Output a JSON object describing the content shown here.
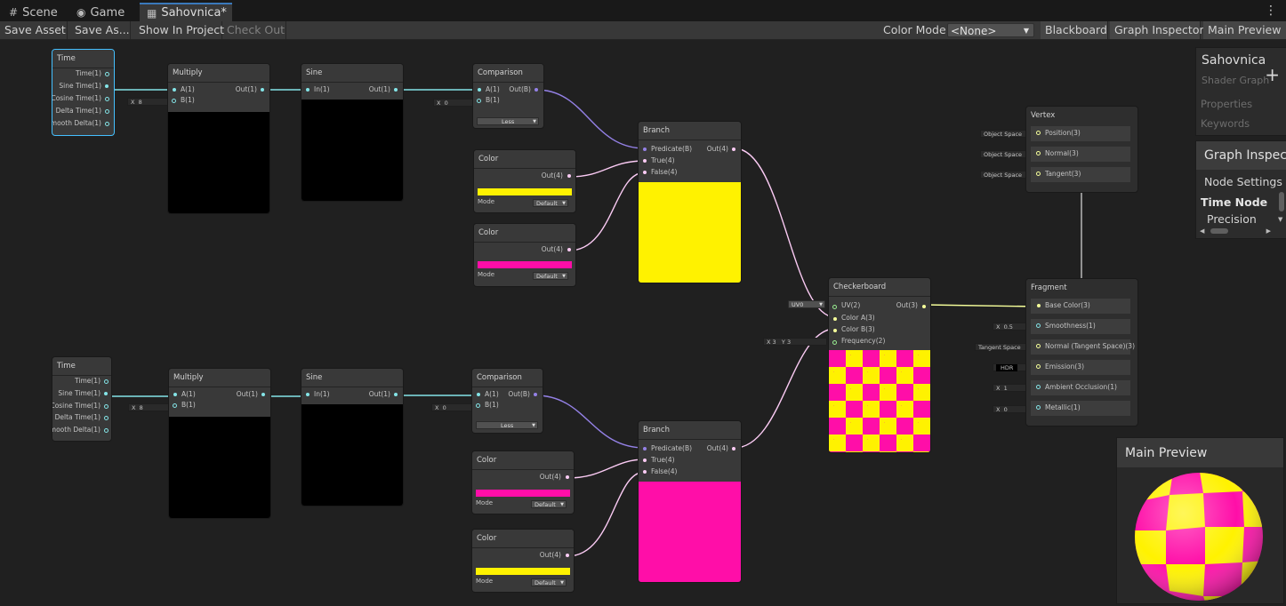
{
  "tabs": [
    {
      "label": "Scene",
      "icon": "grid-icon"
    },
    {
      "label": "Game",
      "icon": "gamepad-icon"
    },
    {
      "label": "Sahovnica*",
      "icon": "shader-graph-icon"
    }
  ],
  "toolbar": {
    "save_asset": "Save Asset",
    "save_as": "Save As...",
    "show_in_project": "Show In Project",
    "check_out": "Check Out",
    "color_mode_label": "Color Mode",
    "color_mode_value": "<None>",
    "blackboard": "Blackboard",
    "graph_inspector": "Graph Inspector",
    "main_preview": "Main Preview"
  },
  "blackboard": {
    "title": "Sahovnica",
    "subtitle": "Shader Graph",
    "add": "+",
    "sections": [
      "Properties",
      "Keywords"
    ]
  },
  "graph_inspector": {
    "title": "Graph Inspec",
    "tab": "Node Settings",
    "heading": "Time Node",
    "row": "Precision"
  },
  "main_preview": {
    "title": "Main Preview"
  },
  "nodes": {
    "time": {
      "title": "Time",
      "ports": [
        "Time(1)",
        "Sine Time(1)",
        "Cosine Time(1)",
        "Delta Time(1)",
        "Smooth Delta(1)"
      ]
    },
    "multiply": {
      "title": "Multiply",
      "in_a": "A(1)",
      "in_b": "B(1)",
      "out": "Out(1)",
      "b_axis": "X",
      "b_value": "8"
    },
    "sine": {
      "title": "Sine",
      "in": "In(1)",
      "out": "Out(1)"
    },
    "comparison": {
      "title": "Comparison",
      "in_a": "A(1)",
      "in_b": "B(1)",
      "out": "Out(B)",
      "b_axis": "X",
      "b_value": "0",
      "op": "Less"
    },
    "branch": {
      "title": "Branch",
      "ports": [
        "Predicate(B)",
        "True(4)",
        "False(4)"
      ],
      "out": "Out(4)"
    },
    "color": {
      "title": "Color",
      "out": "Out(4)",
      "mode_label": "Mode",
      "mode": "Default"
    },
    "checkerboard": {
      "title": "Checkerboard",
      "ports": [
        "UV(2)",
        "Color A(3)",
        "Color B(3)",
        "Frequency(2)"
      ],
      "out": "Out(3)",
      "uv": "UV0",
      "freq_x_axis": "X",
      "freq_x": "3",
      "freq_y_axis": "Y",
      "freq_y": "3"
    },
    "vertex": {
      "title": "Vertex",
      "ports": [
        "Position(3)",
        "Normal(3)",
        "Tangent(3)"
      ],
      "space": "Object Space"
    },
    "fragment": {
      "title": "Fragment",
      "ports": [
        "Base Color(3)",
        "Smoothness(1)",
        "Normal (Tangent Space)(3)",
        "Emission(3)",
        "Ambient Occlusion(1)",
        "Metallic(1)"
      ],
      "controls": [
        {
          "axis": "X",
          "value": "0.5"
        },
        {
          "label": "Tangent Space"
        },
        {
          "label": "HDR"
        },
        {
          "axis": "X",
          "value": "1"
        },
        {
          "axis": "X",
          "value": "0"
        }
      ]
    }
  },
  "colors": {
    "yellow": "#fff200",
    "magenta": "#ff0ea8",
    "float": "#84e4e7",
    "bool": "#9481e6",
    "vector4": "#fbcbf4",
    "vector3": "#f6ff9a",
    "vector2": "#9aef92",
    "selection": "#44c0ff"
  }
}
